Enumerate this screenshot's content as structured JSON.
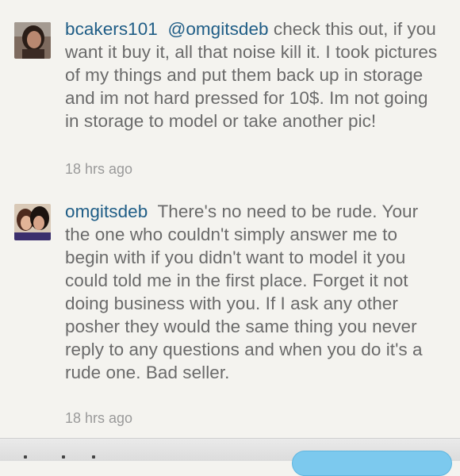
{
  "comments": [
    {
      "username": "bcakers101",
      "mention": "@omgitsdeb",
      "body": "check this out, if you want it buy it, all that noise kill it. I took pictures of my things and put them back up in storage and im not hard pressed for 10$. Im not going in storage to model or take another pic!",
      "time": "18 hrs ago"
    },
    {
      "username": "omgitsdeb",
      "body": "There's no need to be rude. Your the one who couldn't simply answer me to begin with if you didn't want to model it you could told me in the first place. Forget it not doing business with you. If I ask any other posher they would the same thing you never reply to any questions and when you do it's a rude one. Bad seller.",
      "time": "18 hrs ago"
    }
  ]
}
